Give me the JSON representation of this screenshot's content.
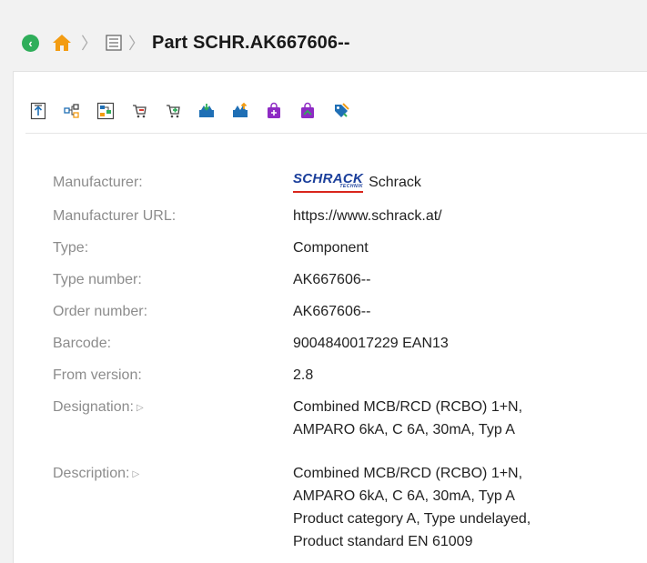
{
  "header": {
    "title": "Part SCHR.AK667606--"
  },
  "toolbar": {
    "icons": [
      "upload-icon",
      "components-icon",
      "tree-icon",
      "cart-remove-icon",
      "cart-add-icon",
      "import-icon",
      "export-icon",
      "bag-add-icon",
      "bag-edit-icon",
      "tag-icon"
    ]
  },
  "properties": {
    "manufacturer": {
      "label": "Manufacturer:",
      "value": "Schrack",
      "logo_text": "SCHRACK",
      "logo_sub": "TECHNIK"
    },
    "manufacturer_url": {
      "label": "Manufacturer URL:",
      "value": "https://www.schrack.at/"
    },
    "type": {
      "label": "Type:",
      "value": "Component"
    },
    "type_number": {
      "label": "Type number:",
      "value": "AK667606--"
    },
    "order_number": {
      "label": "Order number:",
      "value": "AK667606--"
    },
    "barcode": {
      "label": "Barcode:",
      "value": "9004840017229 EAN13"
    },
    "from_version": {
      "label": "From version:",
      "value": "2.8"
    },
    "designation": {
      "label": "Designation:",
      "lines": [
        "Combined MCB/RCD (RCBO) 1+N,",
        "AMPARO 6kA, C 6A, 30mA, Typ A"
      ]
    },
    "description": {
      "label": "Description:",
      "lines": [
        "Combined MCB/RCD (RCBO) 1+N,",
        "AMPARO 6kA, C 6A, 30mA, Typ A",
        "Product category A, Type undelayed,",
        "Product standard EN 61009"
      ]
    }
  },
  "colors": {
    "back": "#2fae5a",
    "home": "#f39c12",
    "accent": "#1f6fb5",
    "cart_red": "#d9261c",
    "cart_green": "#2fae5a",
    "bag": "#8e2bc4",
    "logo_blue": "#1b3f9b"
  }
}
